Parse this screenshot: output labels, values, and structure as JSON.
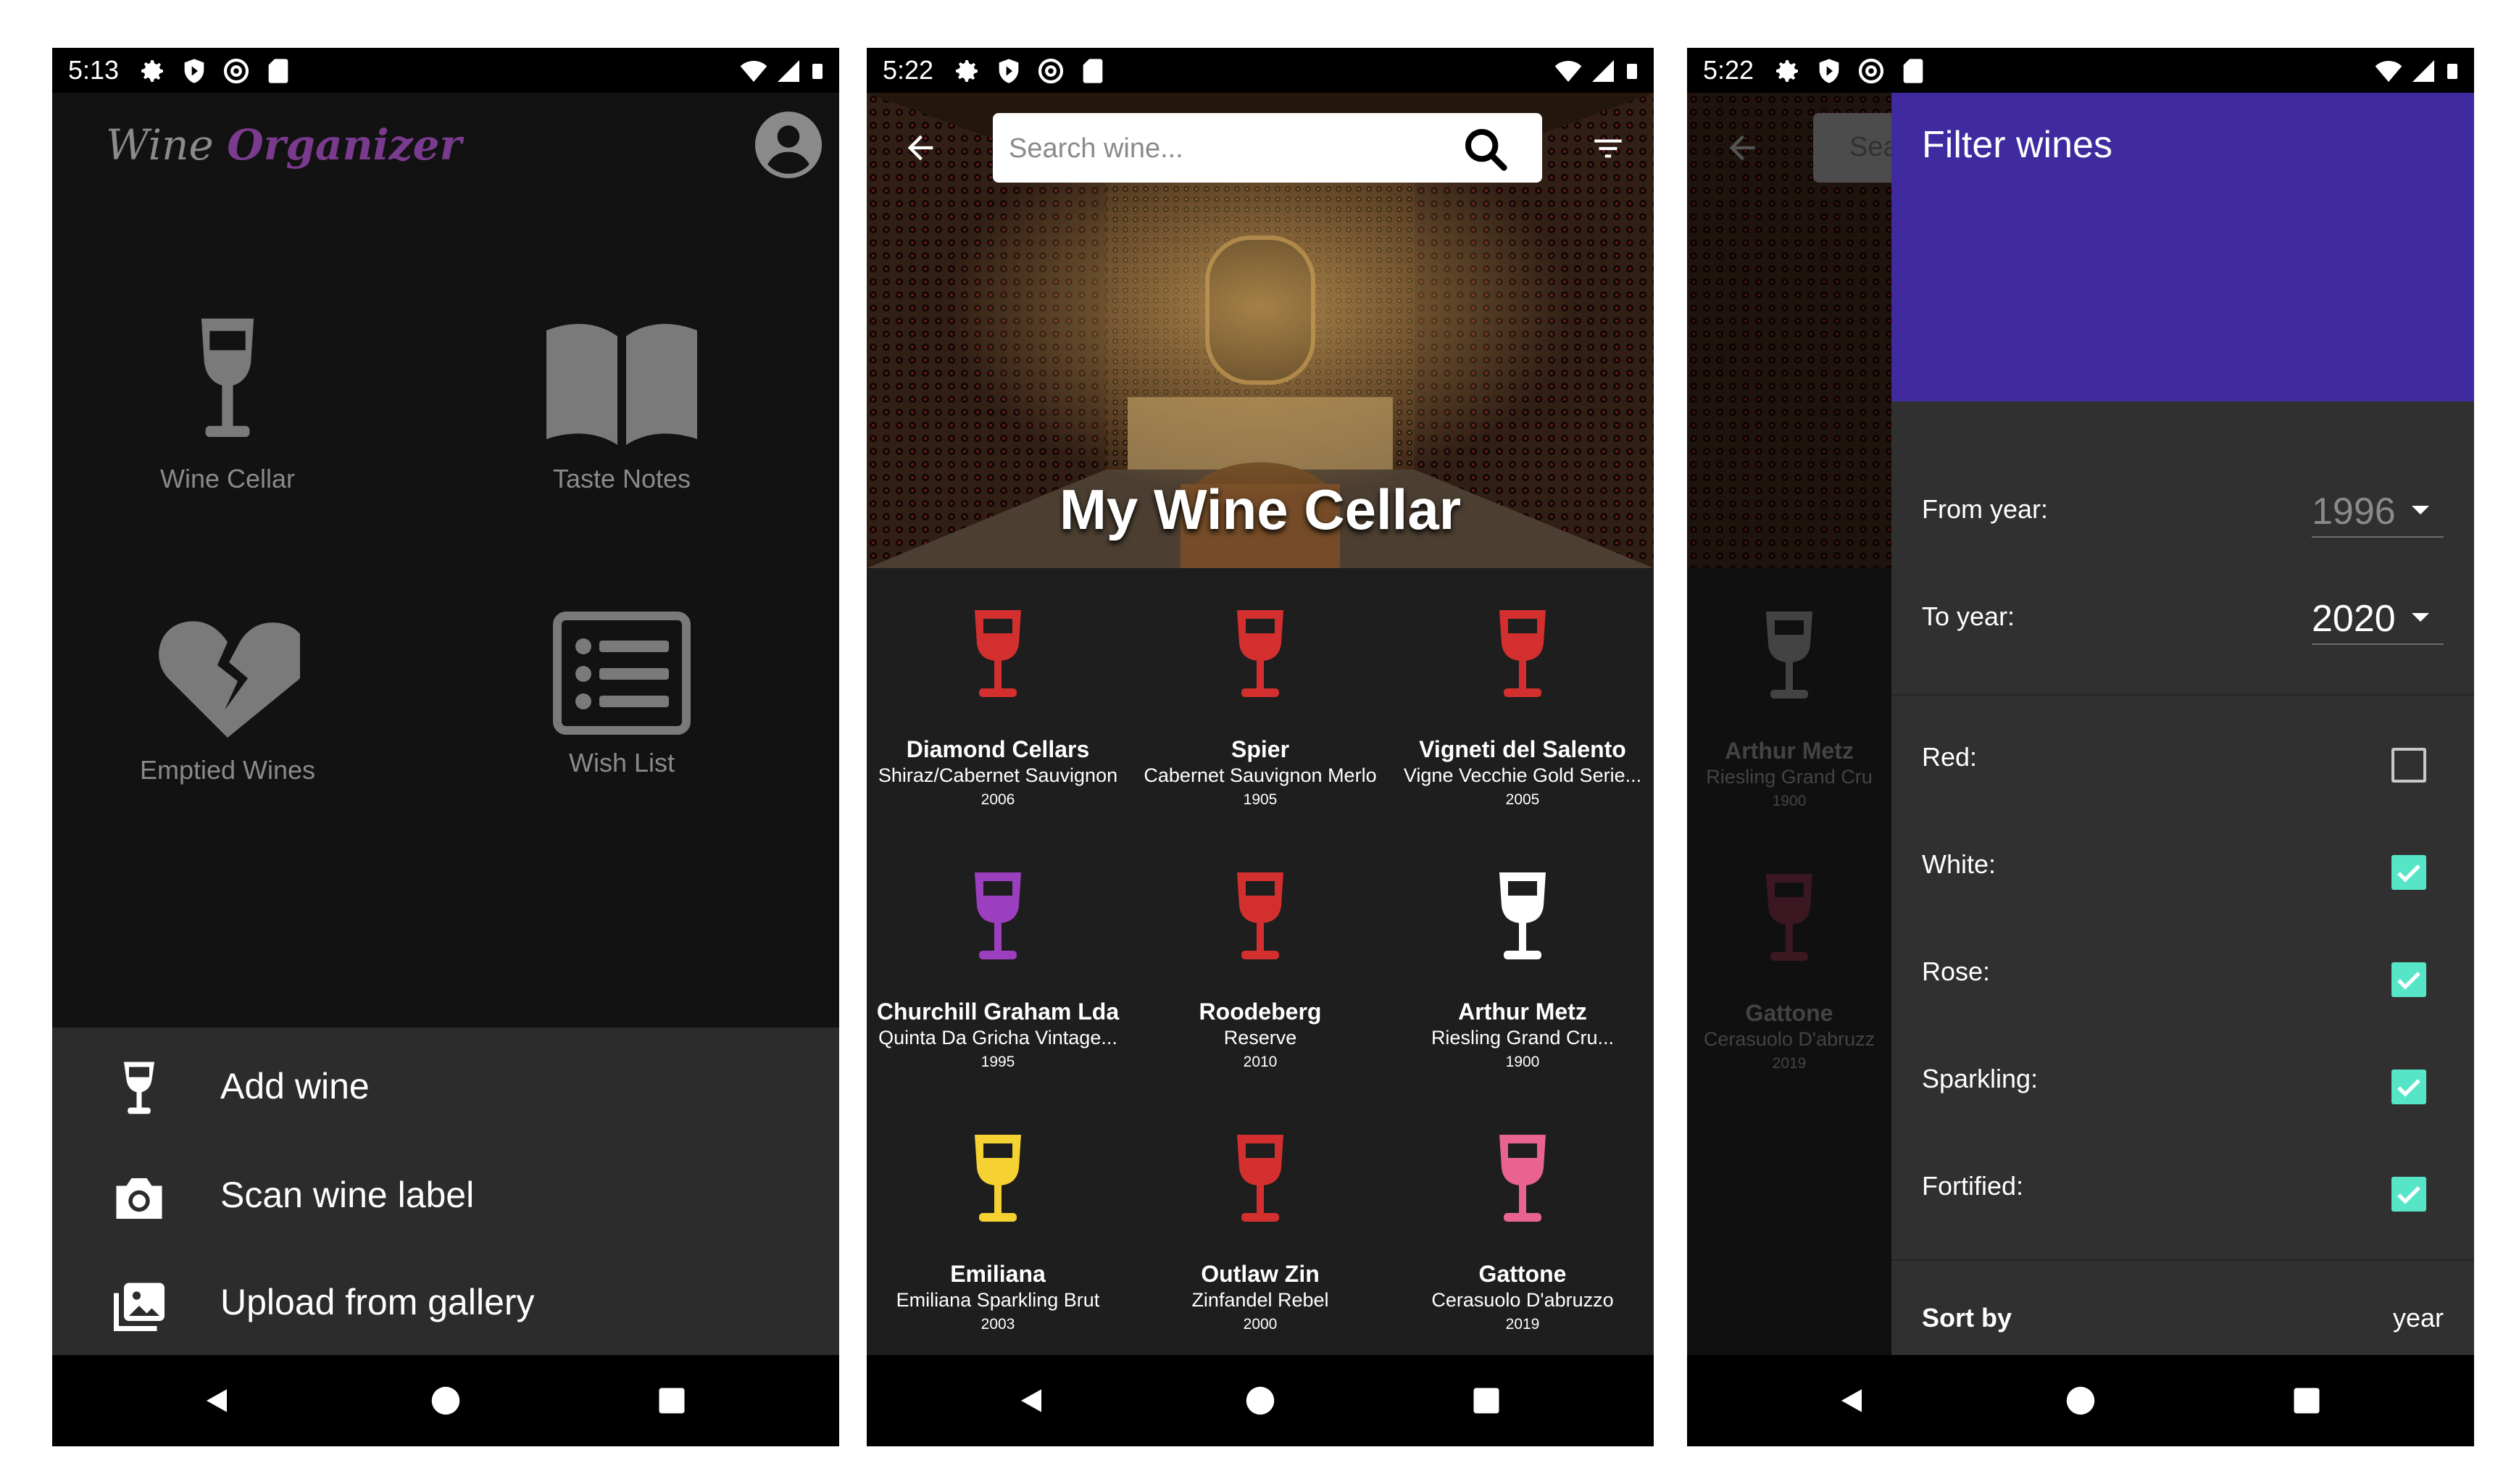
{
  "status_bars": [
    {
      "time": "5:13"
    },
    {
      "time": "5:22"
    },
    {
      "time": "5:22"
    }
  ],
  "screen_home": {
    "logo": {
      "part1": "Wine ",
      "part2": "Organizer"
    },
    "tiles": [
      {
        "label": "Wine Cellar",
        "icon": "wine-glass-icon"
      },
      {
        "label": "Taste Notes",
        "icon": "open-book-icon"
      },
      {
        "label": "Emptied Wines",
        "icon": "broken-heart-icon"
      },
      {
        "label": "Wish List",
        "icon": "list-icon"
      }
    ],
    "sheet": [
      {
        "label": "Add wine",
        "icon": "wine-glass-icon"
      },
      {
        "label": "Scan wine label",
        "icon": "camera-icon"
      },
      {
        "label": "Upload from gallery",
        "icon": "gallery-icon"
      }
    ]
  },
  "screen_cellar": {
    "search_placeholder": "Search wine...",
    "title": "My Wine Cellar",
    "wines": [
      {
        "name": "Diamond Cellars",
        "sub": "Shiraz/Cabernet Sauvignon",
        "year": "2006",
        "color": "#d32f2f"
      },
      {
        "name": "Spier",
        "sub": "Cabernet Sauvignon Merlo",
        "year": "1905",
        "color": "#d32f2f"
      },
      {
        "name": "Vigneti del Salento",
        "sub": "Vigne Vecchie Gold Serie...",
        "year": "2005",
        "color": "#d32f2f"
      },
      {
        "name": "Churchill Graham Lda",
        "sub": "Quinta Da Gricha Vintage...",
        "year": "1995",
        "color": "#9c3fbf"
      },
      {
        "name": "Roodeberg",
        "sub": "Reserve",
        "year": "2010",
        "color": "#d32f2f"
      },
      {
        "name": "Arthur Metz",
        "sub": "Riesling Grand Cru...",
        "year": "1900",
        "color": "#ffffff"
      },
      {
        "name": "Emiliana",
        "sub": "Emiliana Sparkling Brut",
        "year": "2003",
        "color": "#f5d131"
      },
      {
        "name": "Outlaw Zin",
        "sub": "Zinfandel Rebel",
        "year": "2000",
        "color": "#d32f2f"
      },
      {
        "name": "Gattone",
        "sub": "Cerasuolo D'abruzzo",
        "year": "2019",
        "color": "#e8638f"
      }
    ]
  },
  "screen_filter": {
    "search_partial": "Sea",
    "behind_items": [
      {
        "name": "Arthur Metz",
        "sub": "Riesling Grand Cru",
        "year": "1900",
        "color": "#7a7a7a"
      },
      {
        "name": "Gattone",
        "sub": "Cerasuolo D'abruzz",
        "year": "2019",
        "color": "#6b2a3c"
      }
    ],
    "title": "Filter wines",
    "from_label": "From year:",
    "from_value": "1996",
    "to_label": "To year:",
    "to_value": "2020",
    "types": [
      {
        "label": "Red:",
        "checked": false
      },
      {
        "label": "White:",
        "checked": true
      },
      {
        "label": "Rose:",
        "checked": true
      },
      {
        "label": "Sparkling:",
        "checked": true
      },
      {
        "label": "Fortified:",
        "checked": true
      }
    ],
    "sort_label": "Sort by",
    "sort_value": "year"
  }
}
